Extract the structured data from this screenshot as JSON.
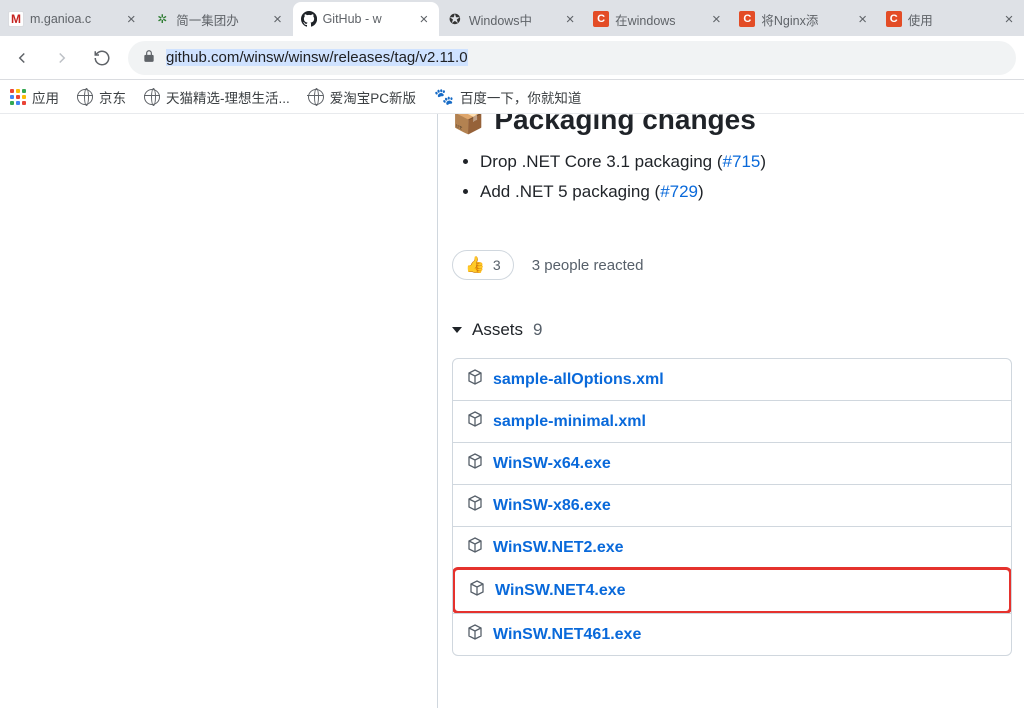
{
  "tabs": [
    {
      "title": "m.ganioa.c",
      "favicon": "m"
    },
    {
      "title": "简一集团办",
      "favicon": "flower"
    },
    {
      "title": "GitHub - w",
      "favicon": "gh",
      "active": true
    },
    {
      "title": "Windows中",
      "favicon": "win"
    },
    {
      "title": "在windows",
      "favicon": "c"
    },
    {
      "title": "将Nginx添",
      "favicon": "c"
    },
    {
      "title": "使用",
      "favicon": "c"
    }
  ],
  "url": "github.com/winsw/winsw/releases/tag/v2.11.0",
  "bookmarks": {
    "apps_label": "应用",
    "items": [
      {
        "label": "京东",
        "icon": "globe"
      },
      {
        "label": "天猫精选-理想生活...",
        "icon": "globe"
      },
      {
        "label": "爱淘宝PC新版",
        "icon": "globe"
      },
      {
        "label": "百度一下，你就知道",
        "icon": "paw"
      }
    ]
  },
  "apps_colors": [
    "#ea4335",
    "#fbbc05",
    "#34a853",
    "#4285f4",
    "#ea4335",
    "#fbbc05",
    "#34a853",
    "#4285f4",
    "#ea4335"
  ],
  "heading": "Packaging changes",
  "changes": [
    {
      "text": "Drop .NET Core 3.1 packaging (",
      "link": "#715",
      "after": ")"
    },
    {
      "text": "Add .NET 5 packaging (",
      "link": "#729",
      "after": ")"
    }
  ],
  "reactions": {
    "count": "3",
    "caption": "3 people reacted"
  },
  "assets": {
    "label": "Assets",
    "count": "9"
  },
  "asset_items": [
    {
      "name": "sample-allOptions.xml"
    },
    {
      "name": "sample-minimal.xml"
    },
    {
      "name": "WinSW-x64.exe"
    },
    {
      "name": "WinSW-x86.exe"
    },
    {
      "name": "WinSW.NET2.exe"
    },
    {
      "name": "WinSW.NET4.exe",
      "highlight": true
    },
    {
      "name": "WinSW.NET461.exe"
    }
  ]
}
